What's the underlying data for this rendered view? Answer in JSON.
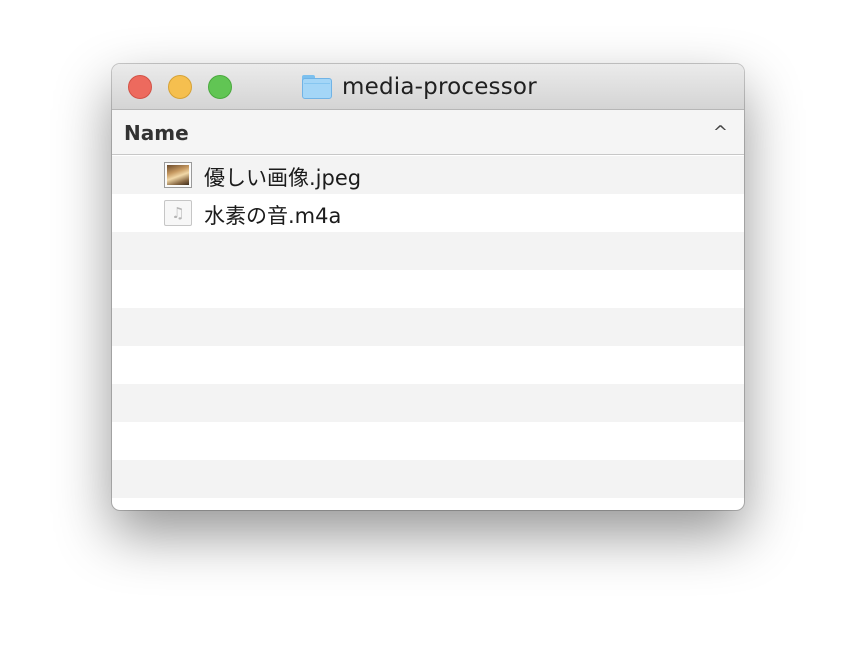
{
  "window": {
    "title": "media-processor",
    "folder_icon": "folder-icon"
  },
  "column": {
    "name_label": "Name",
    "sort_indicator": "^"
  },
  "files": [
    {
      "name": "優しい画像.jpeg",
      "icon": "image-file-icon"
    },
    {
      "name": "水素の音.m4a",
      "icon": "audio-file-icon",
      "glyph": "♫"
    }
  ]
}
